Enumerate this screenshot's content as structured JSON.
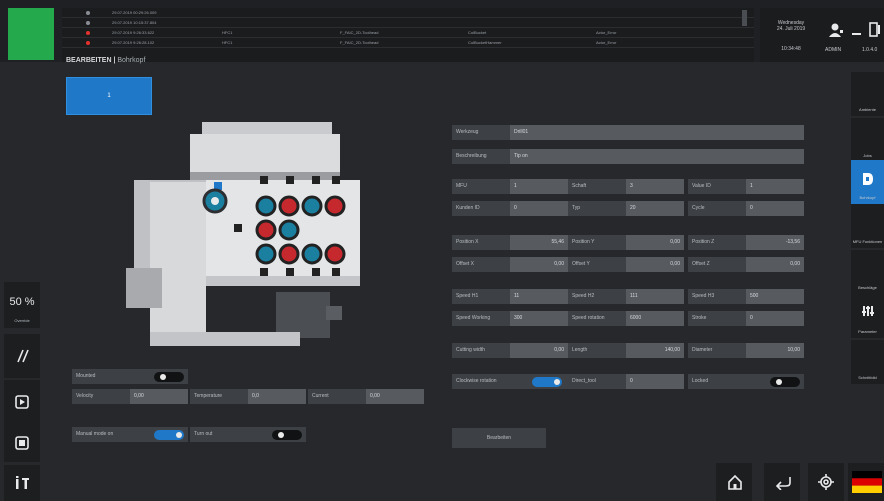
{
  "alarm_rows": [
    {
      "time": "29.07.2019 00:29:26.009",
      "source": "",
      "module": "",
      "type": "",
      "msg": "",
      "level": "dim"
    },
    {
      "time": "29.07.2019 10:15:37.804",
      "source": "",
      "module": "",
      "type": "",
      "msg": "",
      "level": "dim"
    },
    {
      "time": "29.07.2019 9:26:33.622",
      "source": "HFC1",
      "module": "F_FAIC_2D-Toolhead",
      "type": "ColBucket",
      "msg": "Actor_Error",
      "level": "error"
    },
    {
      "time": "29.07.2019 9:26:28.102",
      "source": "HFC1",
      "module": "F_FAIC_2D-Toolhead",
      "type": "ColBucketHammer",
      "msg": "Actor_Error",
      "level": "error"
    }
  ],
  "date": {
    "weekday": "Wednesday",
    "date": "24. Juli 2019",
    "time": "10:34:48"
  },
  "user": {
    "name": "ADMIN",
    "version": "1.0.4.0"
  },
  "breadcrumb": {
    "title": "BEARBEITEN",
    "sep": " | ",
    "sub": "Bohrkopf"
  },
  "tab": {
    "label": "1"
  },
  "override": {
    "value": "50 %",
    "label": "Override"
  },
  "right_rail": [
    {
      "label": "Ambiente",
      "icon": "ambient-icon"
    },
    {
      "label": "Jobs",
      "icon": "jobs-icon"
    },
    {
      "label": "Bohrkopf",
      "icon": "drill-icon",
      "active": true
    },
    {
      "label": "MFU Funktionen",
      "icon": "mfu-icon"
    },
    {
      "label": "Beschläge",
      "icon": "fitting-icon"
    },
    {
      "label": "Parameter",
      "icon": "parameter-icon"
    },
    {
      "label": "Schnittbild",
      "icon": "section-icon"
    }
  ],
  "form": {
    "werkzeug": {
      "label": "Werkzeug",
      "value": "Drill01"
    },
    "beschreibung": {
      "label": "Beschreibung",
      "value": "Tip on"
    },
    "mfu": {
      "label": "MFU",
      "value": "1"
    },
    "schaft": {
      "label": "Schaft",
      "value": "3"
    },
    "value_id": {
      "label": "Value ID",
      "value": "1"
    },
    "kunden_id": {
      "label": "Kunden ID",
      "value": "0"
    },
    "typ": {
      "label": "Typ",
      "value": "20"
    },
    "cycle": {
      "label": "Cycle",
      "value": "0"
    },
    "position_x": {
      "label": "Position X",
      "value": "55,46"
    },
    "position_y": {
      "label": "Position Y",
      "value": "0,00"
    },
    "position_z": {
      "label": "Position Z",
      "value": "-13,56"
    },
    "offset_x": {
      "label": "Offset X",
      "value": "0,00"
    },
    "offset_y": {
      "label": "Offset Y",
      "value": "0,00"
    },
    "offset_z": {
      "label": "Offset Z",
      "value": "0,00"
    },
    "speed_h1": {
      "label": "Speed H1",
      "value": "11"
    },
    "speed_h2": {
      "label": "Speed H2",
      "value": "111"
    },
    "speed_h3": {
      "label": "Speed H3",
      "value": "500"
    },
    "speed_working": {
      "label": "Speed Working",
      "value": "300"
    },
    "speed_rotation": {
      "label": "Speed rotation",
      "value": "6000"
    },
    "stroke": {
      "label": "Stroke",
      "value": "0"
    },
    "cutting_width": {
      "label": "Cutting width",
      "value": "0,00"
    },
    "length": {
      "label": "Length",
      "value": "140,00"
    },
    "diameter": {
      "label": "Diameter",
      "value": "10,00"
    },
    "clockwise": {
      "label": "Clockwise rotation",
      "on": true
    },
    "direct_tool": {
      "label": "Direct_tool",
      "value": "0"
    },
    "locked": {
      "label": "Locked",
      "on": false
    },
    "edit_button": {
      "label": "Bearbeiten"
    }
  },
  "lower": {
    "mounted": {
      "label": "Mounted",
      "on": false
    },
    "velocity": {
      "label": "Velocity",
      "value": "0,00"
    },
    "temperature": {
      "label": "Temperature",
      "value": "0,0"
    },
    "current": {
      "label": "Current",
      "value": "0,00"
    },
    "manual_mode": {
      "label": "Manual mode on",
      "on": true
    },
    "turn_out": {
      "label": "Turn out",
      "on": false
    }
  },
  "colors": {
    "accent": "#1f78c8",
    "ok": "#24a94c",
    "error": "#e2322b"
  },
  "flag_colors": [
    "#000000",
    "#dd0000",
    "#ffce00"
  ]
}
